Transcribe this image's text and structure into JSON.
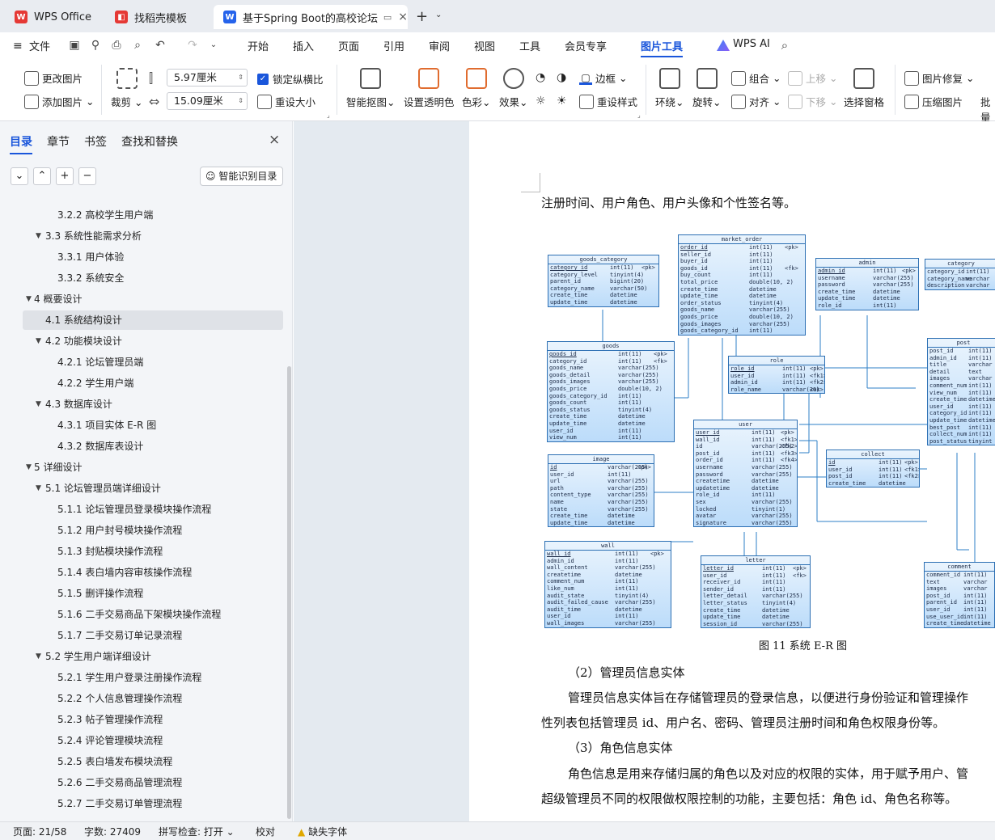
{
  "tabs": [
    {
      "label": "WPS Office",
      "color": "#e53935",
      "glyph": "W"
    },
    {
      "label": "找稻壳模板",
      "color": "#e53935",
      "glyph": "◧"
    },
    {
      "label": "基于Spring Boot的高校论坛",
      "color": "#2563eb",
      "glyph": "W"
    }
  ],
  "menu": {
    "file": "文件",
    "items": [
      "开始",
      "插入",
      "页面",
      "引用",
      "审阅",
      "视图",
      "工具",
      "会员专享",
      "图片工具"
    ],
    "ai": "WPS AI",
    "active": "图片工具"
  },
  "ribbon": {
    "change_image": "更改图片",
    "add_image": "添加图片",
    "crop": "裁剪",
    "width": "5.97厘米",
    "height": "15.09厘米",
    "lock_ratio": "锁定纵横比",
    "resize": "重设大小",
    "smart_cutout": "智能抠图",
    "transparent": "设置透明色",
    "color": "色彩",
    "effect": "效果",
    "border": "边框",
    "reset_style": "重设样式",
    "wrap": "环绕",
    "rotate": "旋转",
    "group": "组合",
    "align": "对齐",
    "up": "上移",
    "down": "下移",
    "select_pane": "选择窗格",
    "repair": "图片修复",
    "compress": "压缩图片",
    "batch": "批量"
  },
  "sidebar": {
    "tabs": [
      "目录",
      "章节",
      "书签",
      "查找和替换"
    ],
    "smart_btn": "智能识别目录",
    "toc": [
      {
        "text": "3.2.2 高校学生用户端",
        "level": 3,
        "arrow": false
      },
      {
        "text": "3.3 系统性能需求分析",
        "level": 2,
        "arrow": true
      },
      {
        "text": "3.3.1 用户体验",
        "level": 3,
        "arrow": false
      },
      {
        "text": "3.3.2 系统安全",
        "level": 3,
        "arrow": false
      },
      {
        "text": "4 概要设计",
        "level": 1,
        "arrow": true
      },
      {
        "text": "4.1 系统结构设计",
        "level": 2,
        "arrow": false,
        "selected": true
      },
      {
        "text": "4.2 功能模块设计",
        "level": 2,
        "arrow": true
      },
      {
        "text": "4.2.1 论坛管理员端",
        "level": 3,
        "arrow": false
      },
      {
        "text": "4.2.2 学生用户端",
        "level": 3,
        "arrow": false
      },
      {
        "text": "4.3 数据库设计",
        "level": 2,
        "arrow": true
      },
      {
        "text": "4.3.1 项目实体 E-R 图",
        "level": 3,
        "arrow": false
      },
      {
        "text": "4.3.2 数据库表设计",
        "level": 3,
        "arrow": false
      },
      {
        "text": "5 详细设计",
        "level": 1,
        "arrow": true
      },
      {
        "text": "5.1 论坛管理员端详细设计",
        "level": 2,
        "arrow": true
      },
      {
        "text": "5.1.1 论坛管理员登录模块操作流程",
        "level": 3,
        "arrow": false
      },
      {
        "text": "5.1.2 用户封号模块操作流程",
        "level": 3,
        "arrow": false
      },
      {
        "text": "5.1.3 封贴模块操作流程",
        "level": 3,
        "arrow": false
      },
      {
        "text": "5.1.4 表白墙内容审核操作流程",
        "level": 3,
        "arrow": false
      },
      {
        "text": "5.1.5 删评操作流程",
        "level": 3,
        "arrow": false
      },
      {
        "text": "5.1.6 二手交易商品下架模块操作流程",
        "level": 3,
        "arrow": false
      },
      {
        "text": "5.1.7 二手交易订单记录流程",
        "level": 3,
        "arrow": false
      },
      {
        "text": "5.2 学生用户端详细设计",
        "level": 2,
        "arrow": true
      },
      {
        "text": "5.2.1 学生用户登录注册操作流程",
        "level": 3,
        "arrow": false
      },
      {
        "text": "5.2.2 个人信息管理操作流程",
        "level": 3,
        "arrow": false
      },
      {
        "text": "5.2.3 帖子管理操作流程",
        "level": 3,
        "arrow": false
      },
      {
        "text": "5.2.4 评论管理模块流程",
        "level": 3,
        "arrow": false
      },
      {
        "text": "5.2.5 表白墙发布模块流程",
        "level": 3,
        "arrow": false
      },
      {
        "text": "5.2.6 二手交易商品管理流程",
        "level": 3,
        "arrow": false
      },
      {
        "text": "5.2.7 二手交易订单管理流程",
        "level": 3,
        "arrow": false
      }
    ]
  },
  "doc": {
    "line1": "注册时间、用户角色、用户头像和个性签名等。",
    "caption": "图 11 系统 E-R 图",
    "h2": "（2）管理员信息实体",
    "p2a": "管理员信息实体旨在存储管理员的登录信息，以便进行身份验证和管理操作",
    "p2b": "性列表包括管理员 id、用户名、密码、管理员注册时间和角色权限身份等。",
    "h3": "（3）角色信息实体",
    "p3a": "角色信息是用来存储归属的角色以及对应的权限的实体，用于赋予用户、管",
    "p3b": "超级管理员不同的权限做权限控制的功能，主要包括：角色 id、角色名称等。"
  },
  "entities": [
    {
      "name": "goods_category",
      "rows": [
        [
          "category_id",
          "int(11)",
          "<pk>"
        ],
        [
          "category_level",
          "tinyint(4)",
          ""
        ],
        [
          "parent_id",
          "bigint(20)",
          ""
        ],
        [
          "category_name",
          "varchar(50)",
          ""
        ],
        [
          "create_time",
          "datetime",
          ""
        ],
        [
          "update_time",
          "datetime",
          ""
        ]
      ]
    },
    {
      "name": "market_order",
      "rows": [
        [
          "order_id",
          "int(11)",
          "<pk>"
        ],
        [
          "seller_id",
          "int(11)",
          ""
        ],
        [
          "buyer_id",
          "int(11)",
          ""
        ],
        [
          "goods_id",
          "int(11)",
          "<fk>"
        ],
        [
          "buy_count",
          "int(11)",
          ""
        ],
        [
          "total_price",
          "double(10, 2)",
          ""
        ],
        [
          "create_time",
          "datetime",
          ""
        ],
        [
          "update_time",
          "datetime",
          ""
        ],
        [
          "order_status",
          "tinyint(4)",
          ""
        ],
        [
          "goods_name",
          "varchar(255)",
          ""
        ],
        [
          "goods_price",
          "double(10, 2)",
          ""
        ],
        [
          "goods_images",
          "varchar(255)",
          ""
        ],
        [
          "goods_category_id",
          "int(11)",
          ""
        ]
      ]
    },
    {
      "name": "admin",
      "rows": [
        [
          "admin_id",
          "int(11)",
          "<pk>"
        ],
        [
          "username",
          "varchar(255)",
          ""
        ],
        [
          "password",
          "varchar(255)",
          ""
        ],
        [
          "create_time",
          "datetime",
          ""
        ],
        [
          "update_time",
          "datetime",
          ""
        ],
        [
          "role_id",
          "int(11)",
          ""
        ]
      ]
    },
    {
      "name": "category",
      "rows": [
        [
          "category_id",
          "int(11)",
          ""
        ],
        [
          "category_name",
          "varchar",
          ""
        ],
        [
          "description",
          "varchar",
          ""
        ]
      ]
    },
    {
      "name": "goods",
      "rows": [
        [
          "goods_id",
          "int(11)",
          "<pk>"
        ],
        [
          "category_id",
          "int(11)",
          "<fk>"
        ],
        [
          "goods_name",
          "varchar(255)",
          ""
        ],
        [
          "goods_detail",
          "varchar(255)",
          ""
        ],
        [
          "goods_images",
          "varchar(255)",
          ""
        ],
        [
          "goods_price",
          "double(10, 2)",
          ""
        ],
        [
          "goods_category_id",
          "int(11)",
          ""
        ],
        [
          "goods_count",
          "int(11)",
          ""
        ],
        [
          "goods_status",
          "tinyint(4)",
          ""
        ],
        [
          "create_time",
          "datetime",
          ""
        ],
        [
          "update_time",
          "datetime",
          ""
        ],
        [
          "user_id",
          "int(11)",
          ""
        ],
        [
          "view_num",
          "int(11)",
          ""
        ]
      ]
    },
    {
      "name": "role",
      "rows": [
        [
          "role_id",
          "int(11)",
          "<pk>"
        ],
        [
          "user_id",
          "int(11)",
          "<fk1>"
        ],
        [
          "admin_id",
          "int(11)",
          "<fk2>"
        ],
        [
          "role_name",
          "varchar(20)",
          "<ak>"
        ]
      ]
    },
    {
      "name": "post",
      "rows": [
        [
          "post_id",
          "int(11)",
          ""
        ],
        [
          "admin_id",
          "int(11)",
          ""
        ],
        [
          "title",
          "varchar",
          ""
        ],
        [
          "detail",
          "text",
          ""
        ],
        [
          "images",
          "varchar",
          ""
        ],
        [
          "comment_num",
          "int(11)",
          ""
        ],
        [
          "view_num",
          "int(11)",
          ""
        ],
        [
          "create_time",
          "datetime",
          ""
        ],
        [
          "user_id",
          "int(11)",
          ""
        ],
        [
          "category_id",
          "int(11)",
          ""
        ],
        [
          "update_time",
          "datetime",
          ""
        ],
        [
          "best_post",
          "int(11)",
          ""
        ],
        [
          "collect_num",
          "int(11)",
          ""
        ],
        [
          "post_status",
          "tinyint",
          ""
        ]
      ]
    },
    {
      "name": "user",
      "rows": [
        [
          "user_id",
          "int(11)",
          "<pk>"
        ],
        [
          "wall_id",
          "int(11)",
          "<fk1>"
        ],
        [
          "id",
          "varchar(255)",
          "<fk2>"
        ],
        [
          "post_id",
          "int(11)",
          "<fk3>"
        ],
        [
          "order_id",
          "int(11)",
          "<fk4>"
        ],
        [
          "username",
          "varchar(255)",
          ""
        ],
        [
          "password",
          "varchar(255)",
          ""
        ],
        [
          "createtime",
          "datetime",
          ""
        ],
        [
          "updatetime",
          "datetime",
          ""
        ],
        [
          "role_id",
          "int(11)",
          ""
        ],
        [
          "sex",
          "varchar(255)",
          ""
        ],
        [
          "locked",
          "tinyint(1)",
          ""
        ],
        [
          "avatar",
          "varchar(255)",
          ""
        ],
        [
          "signature",
          "varchar(255)",
          ""
        ]
      ]
    },
    {
      "name": "image",
      "rows": [
        [
          "id",
          "varchar(255)",
          "<pk>"
        ],
        [
          "user_id",
          "int(11)",
          ""
        ],
        [
          "url",
          "varchar(255)",
          ""
        ],
        [
          "path",
          "varchar(255)",
          ""
        ],
        [
          "content_type",
          "varchar(255)",
          ""
        ],
        [
          "name",
          "varchar(255)",
          ""
        ],
        [
          "state",
          "varchar(255)",
          ""
        ],
        [
          "create_time",
          "datetime",
          ""
        ],
        [
          "update_time",
          "datetime",
          ""
        ]
      ]
    },
    {
      "name": "collect",
      "rows": [
        [
          "id",
          "int(11)",
          "<pk>"
        ],
        [
          "user_id",
          "int(11)",
          "<fk1>"
        ],
        [
          "post_id",
          "int(11)",
          "<fk2>"
        ],
        [
          "create_time",
          "datetime",
          ""
        ]
      ]
    },
    {
      "name": "wall",
      "rows": [
        [
          "wall_id",
          "int(11)",
          "<pk>"
        ],
        [
          "admin_id",
          "int(11)",
          ""
        ],
        [
          "wall_content",
          "varchar(255)",
          ""
        ],
        [
          "createtime",
          "datetime",
          ""
        ],
        [
          "comment_num",
          "int(11)",
          ""
        ],
        [
          "like_num",
          "int(11)",
          ""
        ],
        [
          "audit_state",
          "tinyint(4)",
          ""
        ],
        [
          "audit_failed_cause",
          "varchar(255)",
          ""
        ],
        [
          "audit_time",
          "datetime",
          ""
        ],
        [
          "user_id",
          "int(11)",
          ""
        ],
        [
          "wall_images",
          "varchar(255)",
          ""
        ]
      ]
    },
    {
      "name": "letter",
      "rows": [
        [
          "letter_id",
          "int(11)",
          "<pk>"
        ],
        [
          "user_id",
          "int(11)",
          "<fk>"
        ],
        [
          "receiver_id",
          "int(11)",
          ""
        ],
        [
          "sender_id",
          "int(11)",
          ""
        ],
        [
          "letter_detail",
          "varchar(255)",
          ""
        ],
        [
          "letter_status",
          "tinyint(4)",
          ""
        ],
        [
          "create_time",
          "datetime",
          ""
        ],
        [
          "update_time",
          "datetime",
          ""
        ],
        [
          "session_id",
          "varchar(255)",
          ""
        ]
      ]
    },
    {
      "name": "comment",
      "rows": [
        [
          "comment_id",
          "int(11)",
          ""
        ],
        [
          "text",
          "varchar",
          ""
        ],
        [
          "images",
          "varchar",
          ""
        ],
        [
          "post_id",
          "int(11)",
          ""
        ],
        [
          "parent_id",
          "int(11)",
          ""
        ],
        [
          "user_id",
          "int(11)",
          ""
        ],
        [
          "use_user_id",
          "int(11)",
          ""
        ],
        [
          "create_time",
          "datetime",
          ""
        ]
      ]
    }
  ],
  "status": {
    "page": "页面: 21/58",
    "words": "字数: 27409",
    "spell": "拼写检查: 打开",
    "proof": "校对",
    "font": "缺失字体"
  }
}
